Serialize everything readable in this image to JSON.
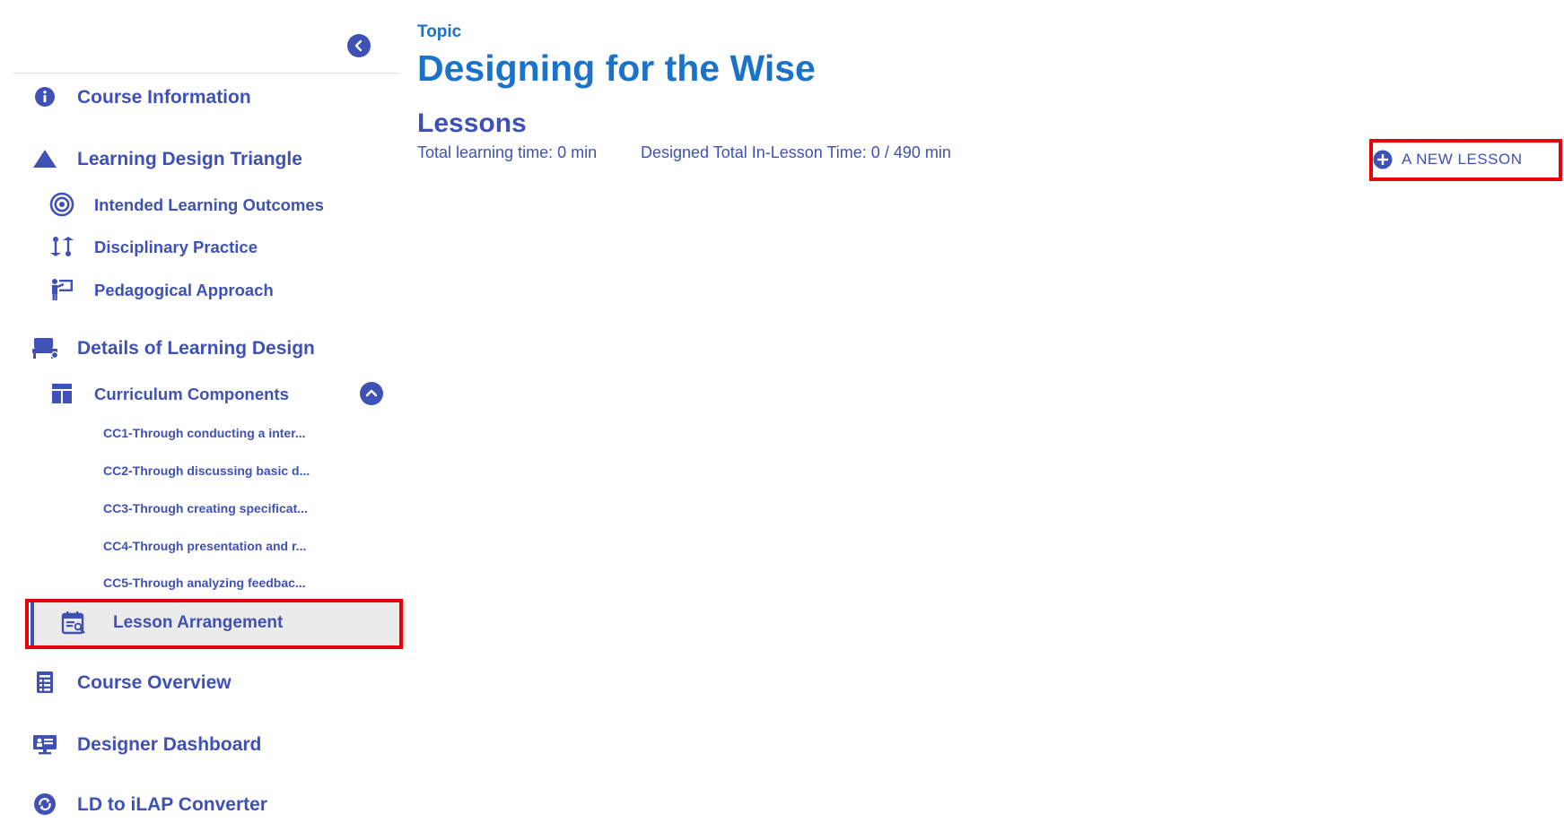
{
  "colors": {
    "primary": "#3f51b5",
    "title_blue": "#1a73c8",
    "highlight_red": "#e8000b",
    "active_bg": "#ebebeb"
  },
  "sidebar": {
    "items": [
      {
        "label": "Course Information",
        "icon": "info-icon"
      },
      {
        "label": "Learning Design Triangle",
        "icon": "triangle-icon"
      },
      {
        "label": "Intended Learning Outcomes",
        "icon": "target-icon"
      },
      {
        "label": "Disciplinary Practice",
        "icon": "swap-vert-icon"
      },
      {
        "label": "Pedagogical Approach",
        "icon": "teacher-board-icon"
      },
      {
        "label": "Details of Learning Design",
        "icon": "desk-icon"
      },
      {
        "label": "Curriculum Components",
        "icon": "dashboard-layout-icon"
      },
      {
        "label": "Lesson Arrangement",
        "icon": "calendar-edit-icon"
      },
      {
        "label": "Course Overview",
        "icon": "document-list-icon"
      },
      {
        "label": "Designer Dashboard",
        "icon": "presentation-icon"
      },
      {
        "label": "LD to iLAP Converter",
        "icon": "sync-icon"
      }
    ],
    "curriculum_components": [
      "CC1-Through conducting a inter...",
      "CC2-Through discussing basic d...",
      "CC3-Through creating specificat...",
      "CC4-Through presentation and r...",
      "CC5-Through analyzing feedbac..."
    ],
    "active_item": "Lesson Arrangement"
  },
  "main": {
    "topic_label": "Topic",
    "title": "Designing for the Wise",
    "section_heading": "Lessons",
    "total_learning_time": "Total learning time: 0 min",
    "designed_total_time": "Designed Total In-Lesson Time: 0 / 490 min",
    "new_lesson_label": "A NEW LESSON"
  }
}
